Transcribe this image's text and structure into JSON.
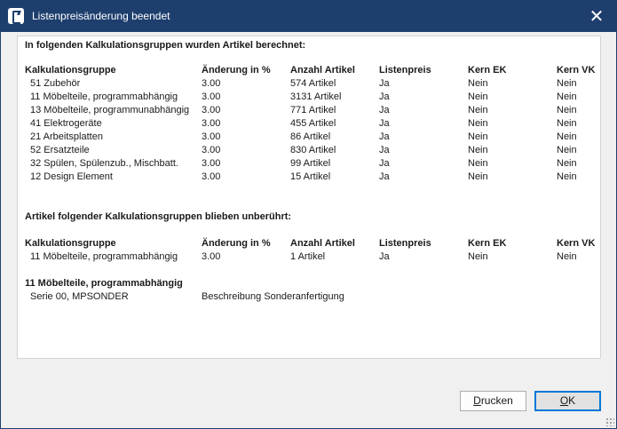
{
  "window": {
    "title": "Listenpreisänderung beendet",
    "close_glyph": "✕",
    "icon": "app-logo-icon"
  },
  "section1": {
    "heading": "In folgenden Kalkulationsgruppen wurden Artikel berechnet:",
    "columns": [
      "Kalkulationsgruppe",
      "Änderung in %",
      "Anzahl Artikel",
      "Listenpreis",
      "Kern EK",
      "Kern VK"
    ],
    "rows": [
      [
        "51 Zubehör",
        "3.00",
        "574 Artikel",
        "Ja",
        "Nein",
        "Nein"
      ],
      [
        "11 Möbelteile, programmabhängig",
        "3.00",
        "3131 Artikel",
        "Ja",
        "Nein",
        "Nein"
      ],
      [
        "13 Möbelteile, programmunabhängig",
        "3.00",
        "771 Artikel",
        "Ja",
        "Nein",
        "Nein"
      ],
      [
        "41 Elektrogeräte",
        "3.00",
        "455 Artikel",
        "Ja",
        "Nein",
        "Nein"
      ],
      [
        "21 Arbeitsplatten",
        "3.00",
        "86 Artikel",
        "Ja",
        "Nein",
        "Nein"
      ],
      [
        "52 Ersatzteile",
        "3.00",
        "830 Artikel",
        "Ja",
        "Nein",
        "Nein"
      ],
      [
        "32 Spülen, Spülenzub., Mischbatt.",
        "3.00",
        "99 Artikel",
        "Ja",
        "Nein",
        "Nein"
      ],
      [
        "12 Design Element",
        "3.00",
        "15 Artikel",
        "Ja",
        "Nein",
        "Nein"
      ]
    ]
  },
  "section2": {
    "heading": "Artikel folgender Kalkulationsgruppen blieben unberührt:",
    "columns": [
      "Kalkulationsgruppe",
      "Änderung in %",
      "Anzahl Artikel",
      "Listenpreis",
      "Kern EK",
      "Kern VK"
    ],
    "rows": [
      [
        "11 Möbelteile, programmabhängig",
        "3.00",
        "1 Artikel",
        "Ja",
        "Nein",
        "Nein"
      ]
    ]
  },
  "section3": {
    "heading": "11 Möbelteile, programmabhängig",
    "rows": [
      [
        "Serie 00, MPSONDER",
        "Beschreibung Sonderanfertigung"
      ]
    ]
  },
  "buttons": {
    "print_mnemonic": "D",
    "print_rest": "rucken",
    "ok_mnemonic": "O",
    "ok_rest": "K"
  }
}
